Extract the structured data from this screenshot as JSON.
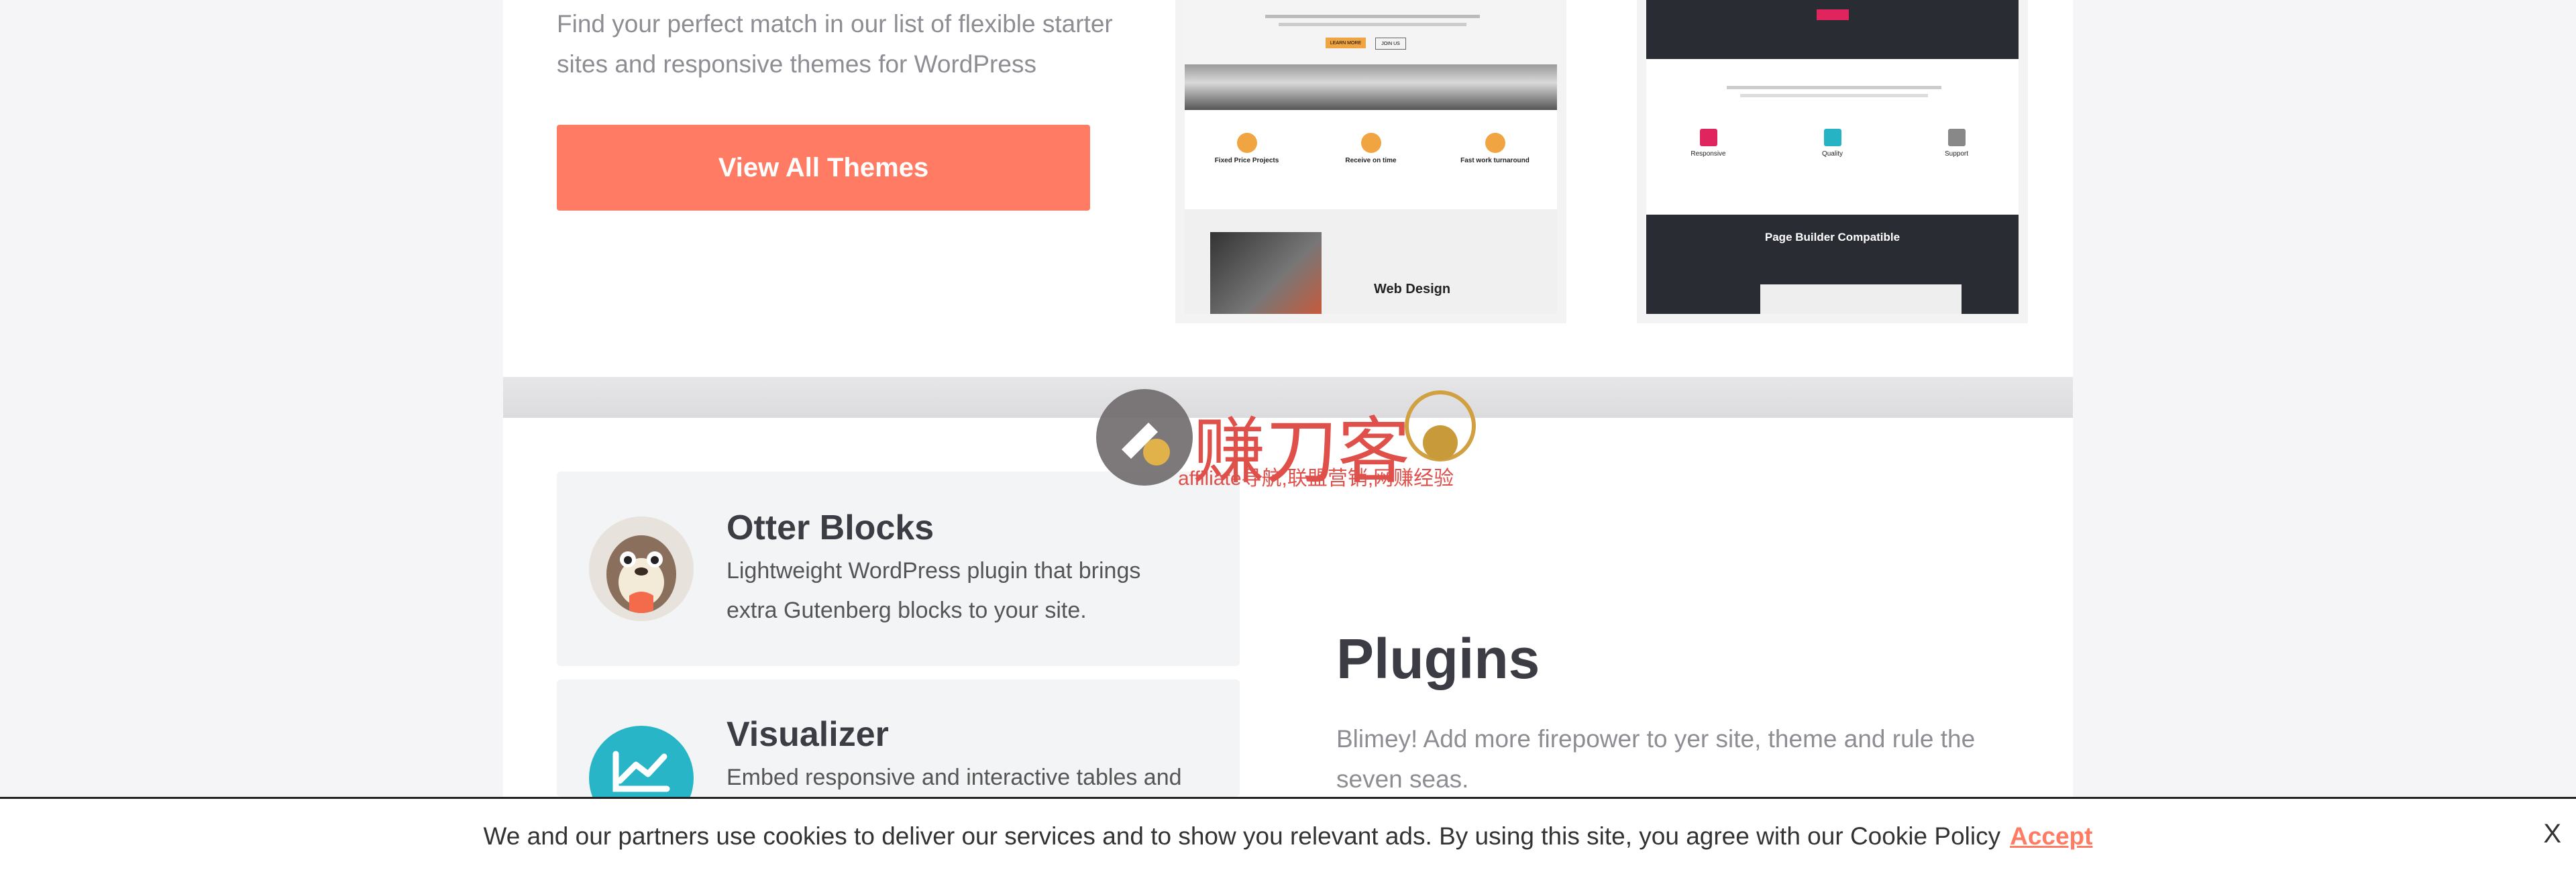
{
  "themes": {
    "description": "Find your perfect match in our list of flexible starter sites and responsive themes for WordPress",
    "button_label": "View All Themes",
    "preview1": {
      "features": [
        "Fixed Price Projects",
        "Receive on time",
        "Fast work turnaround"
      ],
      "btn1": "LEARN MORE",
      "btn2": "JOIN US",
      "section_title": "Web Design"
    },
    "preview2": {
      "features": [
        "Responsive",
        "Quality",
        "Support"
      ],
      "banner_title": "Page Builder Compatible"
    }
  },
  "plugins": {
    "title": "Plugins",
    "description": "Blimey! Add more firepower to yer site, theme and rule the seven seas.",
    "items": [
      {
        "name": "Otter Blocks",
        "desc": "Lightweight WordPress plugin that brings extra Gutenberg blocks to your site."
      },
      {
        "name": "Visualizer",
        "desc": "Embed responsive and interactive tables and"
      }
    ]
  },
  "watermark": {
    "brand": "赚刀客",
    "tagline": "affiliate导航,联盟营销,网赚经验"
  },
  "cookie": {
    "text": "We and our partners use cookies to deliver our services and to show you relevant ads. By using this site, you agree with our Cookie Policy",
    "accept": "Accept",
    "close": "X"
  },
  "colors": {
    "accent": "#ff7b63",
    "heading": "#3c3c44",
    "muted": "#8d8d93"
  }
}
